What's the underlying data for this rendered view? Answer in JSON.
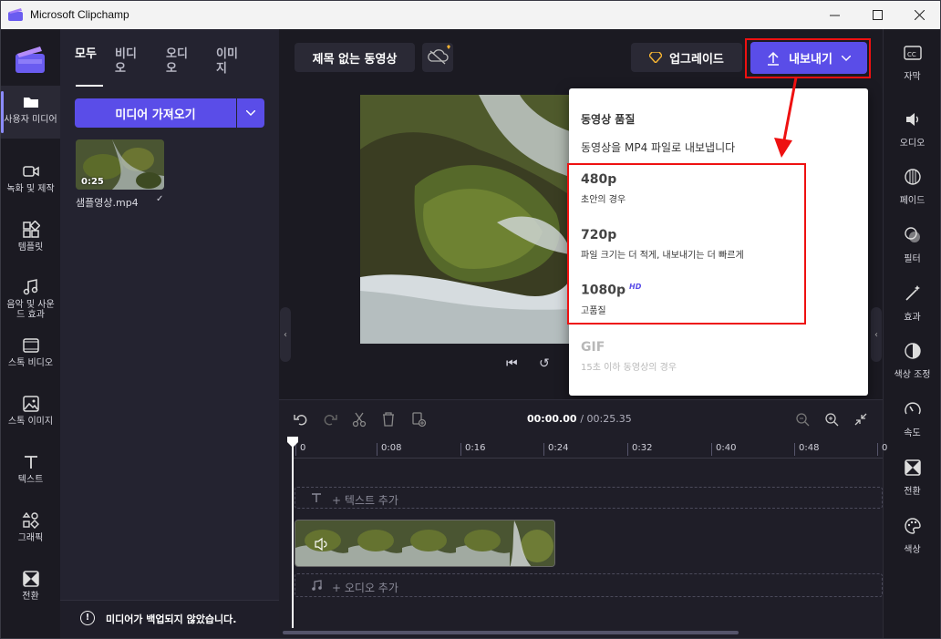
{
  "window": {
    "title": "Microsoft Clipchamp",
    "controls": [
      "minimize",
      "maximize",
      "close"
    ]
  },
  "left_rail": {
    "items": [
      {
        "label": "사용자 미디어",
        "icon": "folder-icon",
        "active": true
      },
      {
        "label": "녹화 및 제작",
        "icon": "video-camera-icon"
      },
      {
        "label": "템플릿",
        "icon": "templates-icon"
      },
      {
        "label": "음악 및 사운드 효과",
        "icon": "music-note-icon"
      },
      {
        "label": "스톡 비디오",
        "icon": "film-icon"
      },
      {
        "label": "스톡 이미지",
        "icon": "image-icon"
      },
      {
        "label": "텍스트",
        "icon": "text-icon"
      },
      {
        "label": "그래픽",
        "icon": "shapes-icon"
      },
      {
        "label": "전환",
        "icon": "transition-icon"
      }
    ]
  },
  "media_panel": {
    "tabs": [
      "모두",
      "비디오",
      "오디오",
      "이미지"
    ],
    "active_tab": "모두",
    "import_button": "미디어 가져오기",
    "media_items": [
      {
        "name": "샘플영상.mp4",
        "duration": "0:25"
      }
    ],
    "backup_notice": "미디어가 백업되지 않았습니다."
  },
  "top_bar": {
    "project_title": "제목 없는 동영상",
    "upgrade_label": "업그레이드",
    "export_label": "내보내기"
  },
  "export_menu": {
    "heading": "동영상 품질",
    "subtitle": "동영상을 MP4 파일로 내보냅니다",
    "options": [
      {
        "quality": "480p",
        "desc": "초안의 경우",
        "badge": "",
        "enabled": true
      },
      {
        "quality": "720p",
        "desc": "파일 크기는 더 적게, 내보내기는 더 빠르게",
        "badge": "",
        "enabled": true
      },
      {
        "quality": "1080p",
        "desc": "고품질",
        "badge": "HD",
        "enabled": true
      },
      {
        "quality": "GIF",
        "desc": "15초 이하 동영상의 경우",
        "badge": "",
        "enabled": false
      }
    ]
  },
  "right_rail": {
    "items": [
      {
        "label": "자막",
        "icon": "captions-icon"
      },
      {
        "label": "오디오",
        "icon": "speaker-icon"
      },
      {
        "label": "페이드",
        "icon": "fade-icon"
      },
      {
        "label": "필터",
        "icon": "filter-icon"
      },
      {
        "label": "효과",
        "icon": "magic-wand-icon"
      },
      {
        "label": "색상 조정",
        "icon": "contrast-icon"
      },
      {
        "label": "속도",
        "icon": "speedometer-icon"
      },
      {
        "label": "전환",
        "icon": "transition-icon"
      },
      {
        "label": "색상",
        "icon": "palette-icon"
      }
    ]
  },
  "timeline": {
    "current_time": "00:00.00",
    "total_time": "/ 00:25.35",
    "ruler_ticks": [
      "0",
      "0:08",
      "0:16",
      "0:24",
      "0:32",
      "0:40",
      "0:48",
      "0"
    ],
    "add_text_label": "+ 텍스트 추가",
    "add_audio_label": "+ 오디오 추가"
  },
  "colors": {
    "accent": "#5a4de8",
    "highlight": "#ee1111",
    "background": "#1b1a22"
  }
}
